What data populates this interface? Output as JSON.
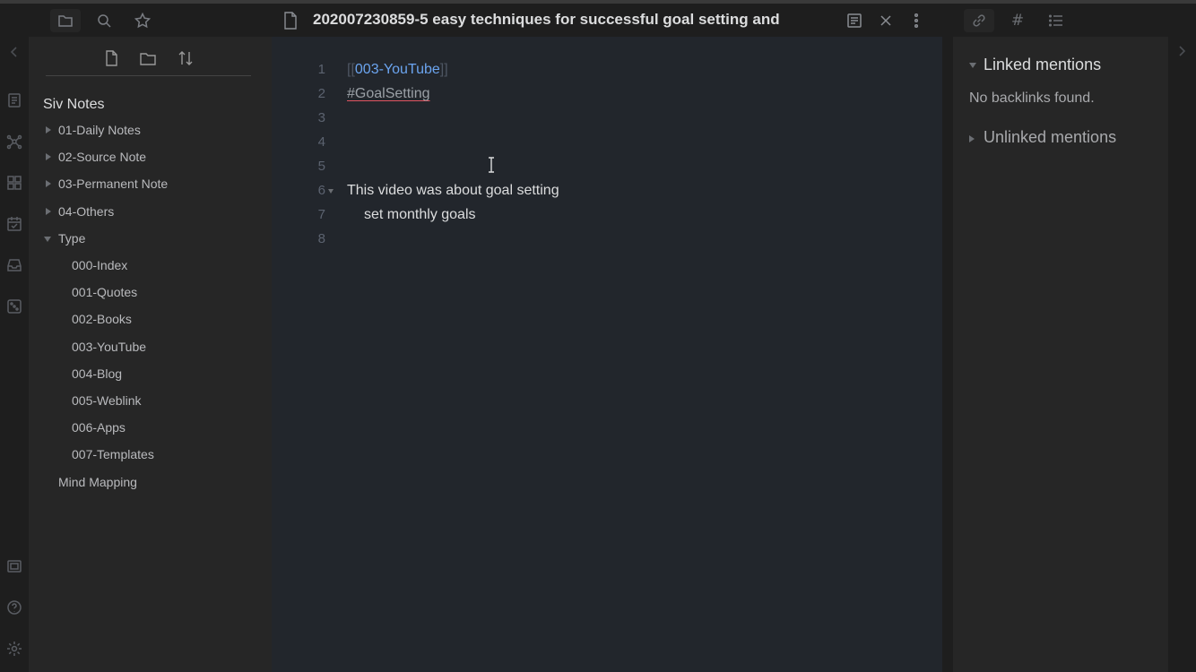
{
  "app": {
    "accent": "#6ba4ef",
    "background": "#1e1e1e"
  },
  "ribbon": {
    "icons": [
      "open-quick-switcher-icon",
      "graph-view-icon",
      "plugins-icon",
      "daily-note-calendar-icon",
      "archive-icon",
      "random-note-icon",
      "vault-switch-icon",
      "help-icon",
      "settings-icon"
    ]
  },
  "left_sidebar": {
    "tabs": [
      "file-explorer-icon",
      "search-icon",
      "starred-icon"
    ],
    "actions": [
      "new-note-icon",
      "new-folder-icon",
      "sort-order-icon"
    ],
    "vault_name": "Siv Notes",
    "tree": [
      {
        "label": "01-Daily Notes",
        "type": "folder",
        "collapsed": true
      },
      {
        "label": "02-Source Note",
        "type": "folder",
        "collapsed": true
      },
      {
        "label": "03-Permanent Note",
        "type": "folder",
        "collapsed": true
      },
      {
        "label": "04-Others",
        "type": "folder",
        "collapsed": true
      },
      {
        "label": "Type",
        "type": "folder",
        "collapsed": false
      },
      {
        "label": "000-Index",
        "type": "file"
      },
      {
        "label": "001-Quotes",
        "type": "file"
      },
      {
        "label": "002-Books",
        "type": "file"
      },
      {
        "label": "003-YouTube",
        "type": "file"
      },
      {
        "label": "004-Blog",
        "type": "file"
      },
      {
        "label": "005-Weblink",
        "type": "file"
      },
      {
        "label": "006-Apps",
        "type": "file"
      },
      {
        "label": "007-Templates",
        "type": "file"
      },
      {
        "label": "Mind Mapping",
        "type": "file"
      }
    ]
  },
  "editor": {
    "tab_title": "202007230859-5 easy techniques for successful goal setting and",
    "line_numbers": [
      "1",
      "2",
      "3",
      "4",
      "5",
      "6",
      "7",
      "8"
    ],
    "line1_open": "[[",
    "line1_link": "003-YouTube",
    "line1_close": "]]",
    "line2_tag": "#GoalSetting",
    "line6_text": "This video was about goal setting",
    "line7_text": "set monthly goals"
  },
  "right_sidebar": {
    "tabs": [
      "backlinks-link-icon",
      "tags-hash-icon",
      "outline-list-icon"
    ],
    "hash_glyph": "#",
    "linked_mentions": "Linked mentions",
    "no_backlinks": "No backlinks found.",
    "unlinked_mentions": "Unlinked mentions"
  }
}
